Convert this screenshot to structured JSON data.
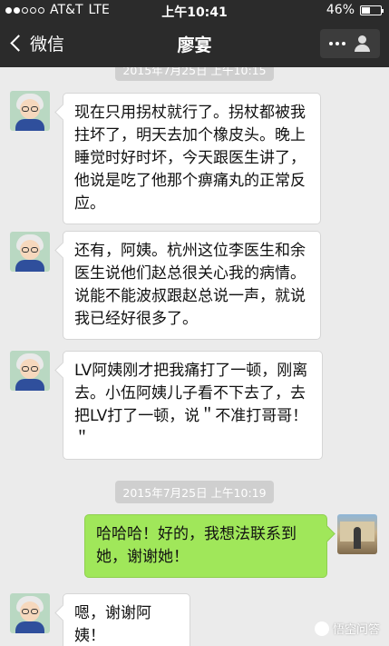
{
  "status": {
    "carrier": "AT&T",
    "network": "LTE",
    "time": "上午10:41",
    "battery": "46%",
    "battery_level": 0.46
  },
  "nav": {
    "back_label": "微信",
    "title": "廖宴"
  },
  "timestamps": [
    "2015年7月25日 上午10:15",
    "2015年7月25日 上午10:19"
  ],
  "messages": [
    {
      "side": "in",
      "text": "现在只用拐杖就行了。拐杖都被我拄坏了，明天去加个橡皮头。晚上睡觉时好时坏，今天跟医生讲了，他说是吃了他那个痹痛丸的正常反应。"
    },
    {
      "side": "in",
      "text": "还有，阿姨。杭州这位李医生和余医生说他们赵总很关心我的病情。说能不能波叔跟赵总说一声，就说我已经好很多了。"
    },
    {
      "side": "in",
      "text": "LV阿姨刚才把我痛打了一顿，刚离去。小伍阿姨儿子看不下去了，去把LV打了一顿，说＂不准打哥哥！＂"
    },
    {
      "side": "out",
      "text": "哈哈哈！好的，我想法联系到她，谢谢她！"
    },
    {
      "side": "in",
      "text": "嗯，谢谢阿姨！"
    }
  ],
  "watermark": "悟空问答"
}
